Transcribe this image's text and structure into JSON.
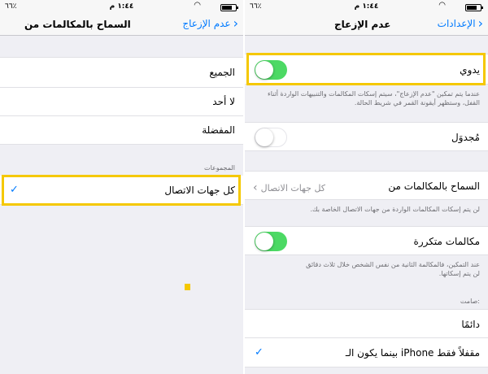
{
  "status_bar": {
    "carrier": "٦٦٪",
    "time": "١:٤٤ م",
    "battery_percent": "٦٦٪"
  },
  "left": {
    "nav": {
      "title": "السماح بالمكالمات من",
      "back_label": "عدم الإزعاج"
    },
    "rows": [
      {
        "label": "الجميع"
      },
      {
        "label": "لا أحد"
      },
      {
        "label": "المفضلة"
      }
    ],
    "groups_header": "المجموعات",
    "group_row": {
      "label": "كل جهات الاتصال",
      "checked": true
    }
  },
  "right": {
    "nav": {
      "title": "عدم الإزعاج",
      "back_label": "الإعدادات"
    },
    "manual": {
      "label": "يدوي",
      "on": true
    },
    "manual_footnote": "عندما يتم تمكين \"عدم الإزعاج\"، سيتم إسكات المكالمات والتنبيهات الواردة أثناء القفل، وستظهر أيقونة القمر في شريط الحالة.",
    "scheduled": {
      "label": "مُجدوَل",
      "on": false
    },
    "allow_calls": {
      "label": "السماح بالمكالمات من",
      "value": "كل جهات الاتصال"
    },
    "allow_calls_footnote": "لن يتم إسكات المكالمات الواردة من جهات الاتصال الخاصة بك.",
    "repeated_calls": {
      "label": "مكالمات متكررة",
      "on": true
    },
    "repeated_footnote": "عند التمكين، فالمكالمة الثانية من نفس الشخص خلال ثلاث دقائق لن يتم إسكاتها.",
    "silence_header": "صامت:",
    "always": {
      "label": "دائمًا"
    },
    "locked_only": {
      "label": "بينما يكون الـ iPhone مقفلاً فقط",
      "checked": true
    }
  },
  "colors": {
    "accent": "#007aff",
    "toggle_on": "#4cd964",
    "highlight": "#f5c800"
  }
}
